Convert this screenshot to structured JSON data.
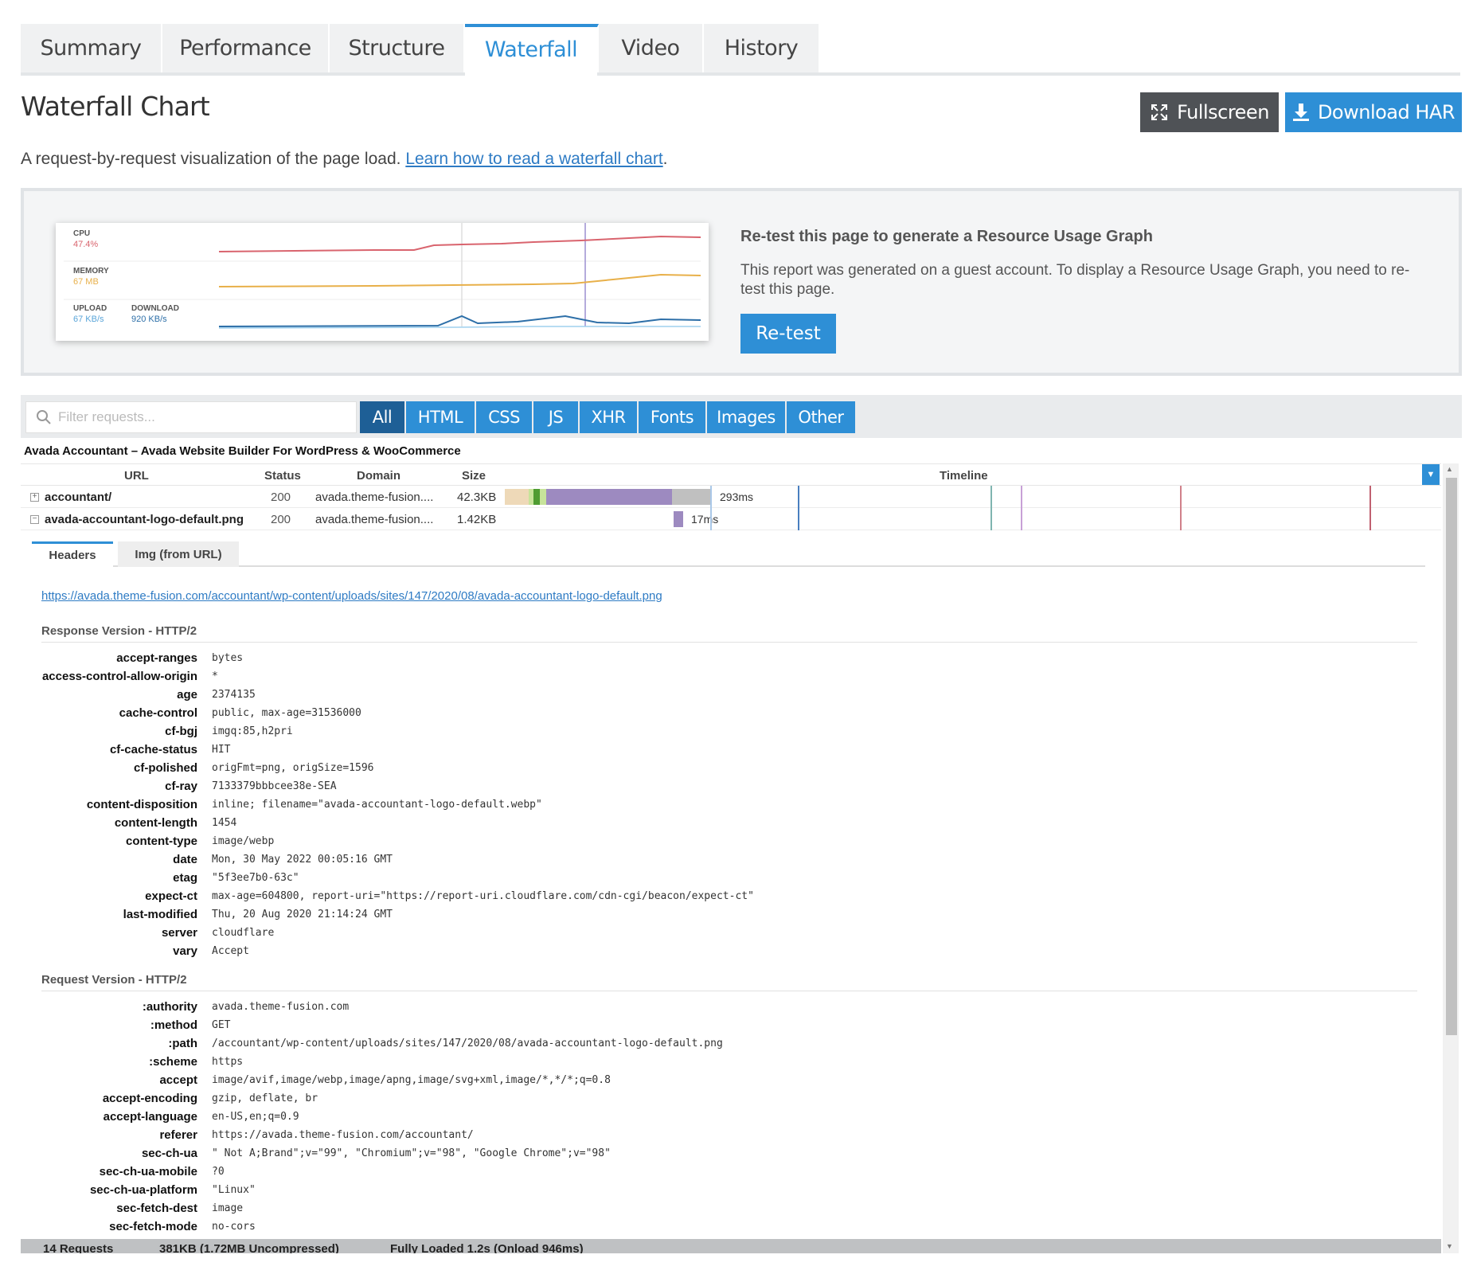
{
  "tabs": [
    {
      "label": "Summary",
      "active": false
    },
    {
      "label": "Performance",
      "active": false
    },
    {
      "label": "Structure",
      "active": false
    },
    {
      "label": "Waterfall",
      "active": true
    },
    {
      "label": "Video",
      "active": false
    },
    {
      "label": "History",
      "active": false
    }
  ],
  "page_title": "Waterfall Chart",
  "buttons": {
    "fullscreen": "Fullscreen",
    "download": "Download HAR"
  },
  "intro": {
    "text": "A request-by-request visualization of the page load. ",
    "link": "Learn how to read a waterfall chart",
    "suffix": "."
  },
  "resource_graph": {
    "cpu_label": "CPU",
    "cpu_value": "47.4%",
    "memory_label": "MEMORY",
    "memory_value": "67 MB",
    "upload_label": "UPLOAD",
    "upload_value": "67 KB/s",
    "download_label": "DOWNLOAD",
    "download_value": "920 KB/s",
    "colors": {
      "cpu": "#d9646e",
      "memory": "#e8b04a",
      "upload": "#5aa5d9",
      "download": "#2d6fa8"
    }
  },
  "retest": {
    "title": "Re-test this page to generate a Resource Usage Graph",
    "text": "This report was generated on a guest account. To display a Resource Usage Graph, you need to re-test this page.",
    "button": "Re-test"
  },
  "filter": {
    "placeholder": "Filter requests...",
    "types": [
      {
        "label": "All",
        "active": true
      },
      {
        "label": "HTML",
        "active": false
      },
      {
        "label": "CSS",
        "active": false
      },
      {
        "label": "JS",
        "active": false
      },
      {
        "label": "XHR",
        "active": false
      },
      {
        "label": "Fonts",
        "active": false
      },
      {
        "label": "Images",
        "active": false
      },
      {
        "label": "Other",
        "active": false
      }
    ]
  },
  "waterfall": {
    "site_title": "Avada Accountant – Avada Website Builder For WordPress & WooCommerce",
    "columns": {
      "url": "URL",
      "status": "Status",
      "domain": "Domain",
      "size": "Size",
      "timeline": "Timeline"
    },
    "rows": [
      {
        "toggle": "+",
        "name": "accountant/",
        "status": "200",
        "domain": "avada.theme-fusion....",
        "size": "42.3KB",
        "time": "293ms"
      },
      {
        "toggle": "−",
        "name": "avada-accountant-logo-default.png",
        "status": "200",
        "domain": "avada.theme-fusion....",
        "size": "1.42KB",
        "time": "17ms"
      }
    ],
    "details": {
      "tabs": [
        "Headers",
        "Img (from URL)"
      ],
      "url": "https://avada.theme-fusion.com/accountant/wp-content/uploads/sites/147/2020/08/avada-accountant-logo-default.png",
      "response_title": "Response Version - HTTP/2",
      "response_headers": [
        {
          "k": "accept-ranges",
          "v": "bytes"
        },
        {
          "k": "access-control-allow-origin",
          "v": "*"
        },
        {
          "k": "age",
          "v": "2374135"
        },
        {
          "k": "cache-control",
          "v": "public, max-age=31536000"
        },
        {
          "k": "cf-bgj",
          "v": "imgq:85,h2pri"
        },
        {
          "k": "cf-cache-status",
          "v": "HIT"
        },
        {
          "k": "cf-polished",
          "v": "origFmt=png, origSize=1596"
        },
        {
          "k": "cf-ray",
          "v": "7133379bbbcee38e-SEA"
        },
        {
          "k": "content-disposition",
          "v": "inline; filename=\"avada-accountant-logo-default.webp\""
        },
        {
          "k": "content-length",
          "v": "1454"
        },
        {
          "k": "content-type",
          "v": "image/webp"
        },
        {
          "k": "date",
          "v": "Mon, 30 May 2022 00:05:16 GMT"
        },
        {
          "k": "etag",
          "v": "\"5f3ee7b0-63c\""
        },
        {
          "k": "expect-ct",
          "v": "max-age=604800, report-uri=\"https://report-uri.cloudflare.com/cdn-cgi/beacon/expect-ct\""
        },
        {
          "k": "last-modified",
          "v": "Thu, 20 Aug 2020 21:14:24 GMT"
        },
        {
          "k": "server",
          "v": "cloudflare"
        },
        {
          "k": "vary",
          "v": "Accept"
        }
      ],
      "request_title": "Request Version - HTTP/2",
      "request_headers": [
        {
          "k": ":authority",
          "v": "avada.theme-fusion.com"
        },
        {
          "k": ":method",
          "v": "GET"
        },
        {
          "k": ":path",
          "v": "/accountant/wp-content/uploads/sites/147/2020/08/avada-accountant-logo-default.png"
        },
        {
          "k": ":scheme",
          "v": "https"
        },
        {
          "k": "accept",
          "v": "image/avif,image/webp,image/apng,image/svg+xml,image/*,*/*;q=0.8"
        },
        {
          "k": "accept-encoding",
          "v": "gzip, deflate, br"
        },
        {
          "k": "accept-language",
          "v": "en-US,en;q=0.9"
        },
        {
          "k": "referer",
          "v": "https://avada.theme-fusion.com/accountant/"
        },
        {
          "k": "sec-ch-ua",
          "v": "\" Not A;Brand\";v=\"99\", \"Chromium\";v=\"98\", \"Google Chrome\";v=\"98\""
        },
        {
          "k": "sec-ch-ua-mobile",
          "v": "?0"
        },
        {
          "k": "sec-ch-ua-platform",
          "v": "\"Linux\""
        },
        {
          "k": "sec-fetch-dest",
          "v": "image"
        },
        {
          "k": "sec-fetch-mode",
          "v": "no-cors"
        }
      ]
    },
    "footer": {
      "requests": "14 Requests",
      "size": "381KB  (1.72MB Uncompressed)",
      "loaded": "Fully Loaded 1.2s  (Onload 946ms)"
    }
  }
}
